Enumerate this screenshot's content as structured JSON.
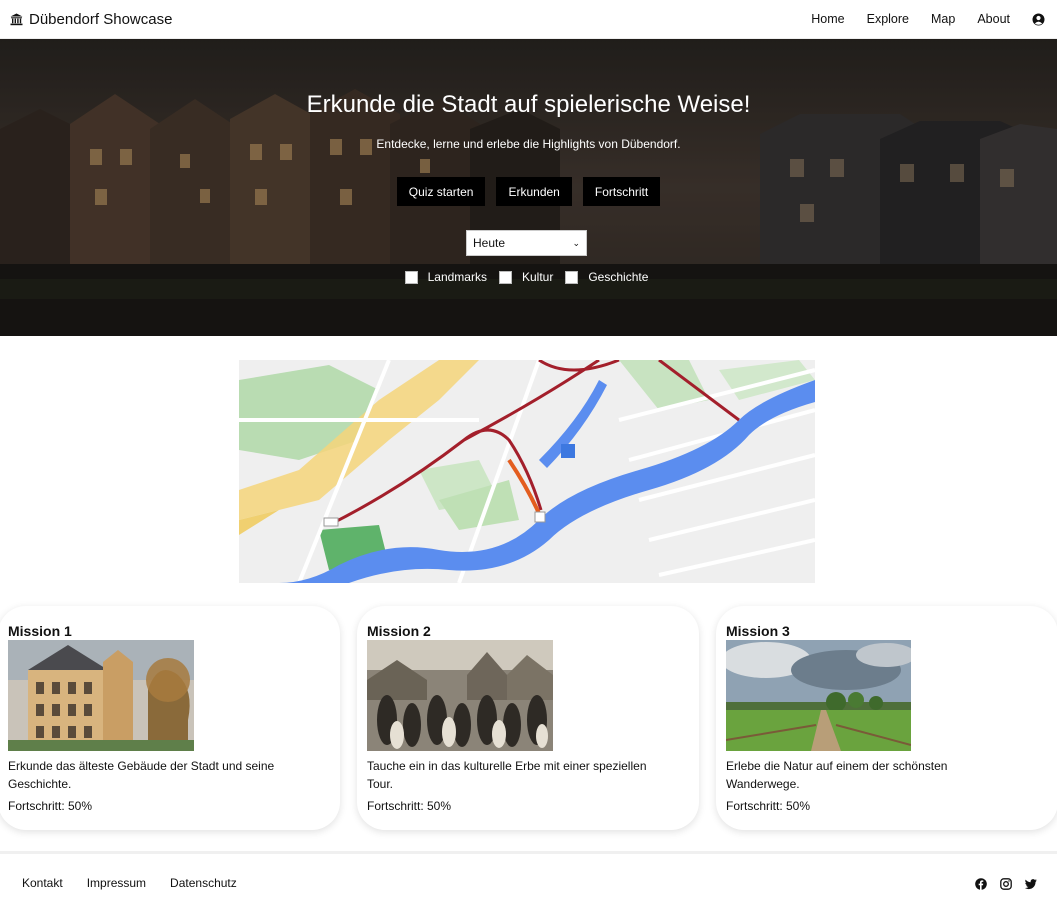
{
  "brand": {
    "title": "Dübendorf Showcase",
    "icon": "landmark-icon"
  },
  "nav": {
    "items": [
      "Home",
      "Explore",
      "Map",
      "About"
    ],
    "user_icon": "user-circle-icon"
  },
  "hero": {
    "title": "Erkunde die Stadt auf spielerische Weise!",
    "subtitle": "Entdecke, lerne und erlebe die Highlights von Dübendorf.",
    "buttons": [
      "Quiz starten",
      "Erkunden",
      "Fortschritt"
    ],
    "select": {
      "value": "Heute",
      "icon": "chevron-down-icon"
    },
    "filters": [
      {
        "label": "Landmarks",
        "checked": false
      },
      {
        "label": "Kultur",
        "checked": false
      },
      {
        "label": "Geschichte",
        "checked": false
      }
    ]
  },
  "missions": [
    {
      "title": "Mission 1",
      "description": "Erkunde das älteste Gebäude der Stadt und seine Geschichte.",
      "progress": "Fortschritt: 50%"
    },
    {
      "title": "Mission 2",
      "description": "Tauche ein in das kulturelle Erbe mit einer speziellen Tour.",
      "progress": "Fortschritt: 50%"
    },
    {
      "title": "Mission 3",
      "description": "Erlebe die Natur auf einem der schönsten Wanderwege.",
      "progress": "Fortschritt: 50%"
    }
  ],
  "footer": {
    "links": [
      "Kontakt",
      "Impressum",
      "Datenschutz"
    ],
    "social_icons": [
      "facebook-icon",
      "instagram-icon",
      "twitter-icon"
    ]
  },
  "colors": {
    "button_bg": "#000000",
    "river": "#5b8def",
    "route": "#a31f2b"
  }
}
